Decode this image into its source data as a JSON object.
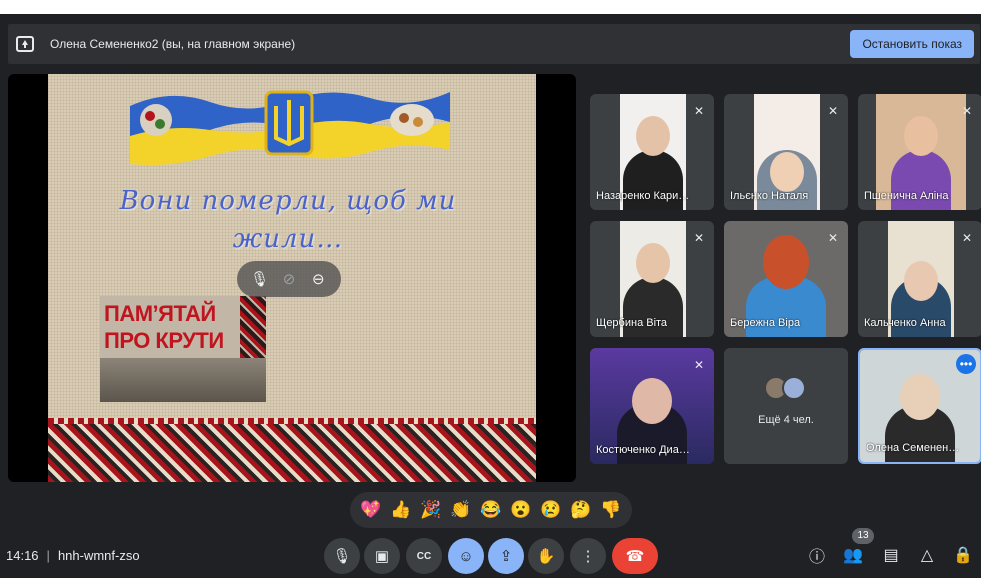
{
  "banner": {
    "title": "Олена Семененко2 (вы, на главном экране)",
    "stop_label": "Остановить показ"
  },
  "slide": {
    "heading_line1": "Вони померли, щоб ми",
    "heading_line2": "жили…",
    "poster_line1": "ПАМ’ЯТАЙ",
    "poster_line2": "ПРО КРУТИ"
  },
  "participants": [
    {
      "name": "Назаренко Кари…",
      "muted": true
    },
    {
      "name": "Ільєнко Наталя",
      "muted": true
    },
    {
      "name": "Пшенична Аліна",
      "muted": true
    },
    {
      "name": "Щербина Віта",
      "muted": true
    },
    {
      "name": "Бережна Віра",
      "muted": true
    },
    {
      "name": "Кальченко Анна",
      "muted": true
    },
    {
      "name": "Костюченко Диа…",
      "muted": true
    },
    {
      "name": "Олена Семенен…",
      "muted": false
    }
  ],
  "more_tile": {
    "label": "Ещё 4 чел."
  },
  "reactions": [
    "💖",
    "👍",
    "🎉",
    "👏",
    "😂",
    "😮",
    "😢",
    "🤔",
    "👎"
  ],
  "meeting": {
    "time": "14:16",
    "code": "hnh-wmnf-zso"
  },
  "people_count": "13",
  "colors": {
    "accent": "#8ab4f8",
    "end_call": "#ea4335",
    "background": "#202124",
    "tile": "#3c4043"
  }
}
